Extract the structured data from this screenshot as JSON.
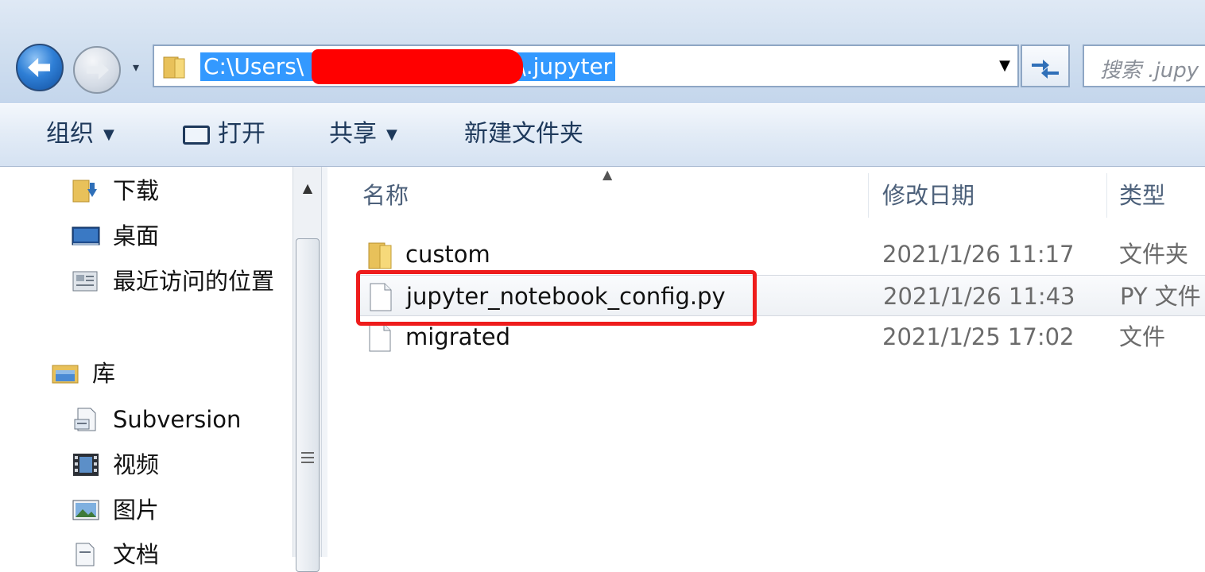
{
  "address_bar": {
    "path_prefix": "C:\\Users\\",
    "path_suffix": "\\.jupyter",
    "search_placeholder": "搜索 .jupy"
  },
  "toolbar": {
    "organize": "组织",
    "open": "打开",
    "share": "共享",
    "new_folder": "新建文件夹"
  },
  "navigation": {
    "items": [
      {
        "label": "下载",
        "icon": "downloads-folder-icon"
      },
      {
        "label": "桌面",
        "icon": "desktop-icon"
      },
      {
        "label": "最近访问的位置",
        "icon": "recent-places-icon"
      },
      {
        "label": "库",
        "icon": "library-icon"
      },
      {
        "label": "Subversion",
        "icon": "document-library-icon"
      },
      {
        "label": "视频",
        "icon": "video-icon"
      },
      {
        "label": "图片",
        "icon": "picture-icon"
      },
      {
        "label": "文档",
        "icon": "document-icon"
      }
    ]
  },
  "columns": {
    "name": "名称",
    "modified": "修改日期",
    "type": "类型"
  },
  "files": [
    {
      "name": "custom",
      "modified": "2021/1/26 11:17",
      "type": "文件夹",
      "icon": "folder-icon"
    },
    {
      "name": "jupyter_notebook_config.py",
      "modified": "2021/1/26 11:43",
      "type": "PY 文件",
      "icon": "file-icon"
    },
    {
      "name": "migrated",
      "modified": "2021/1/25 17:02",
      "type": "文件",
      "icon": "file-icon"
    }
  ],
  "colors": {
    "selection": "#3399ff",
    "annotation": "#ee1c1c",
    "redaction": "#ff0000"
  }
}
